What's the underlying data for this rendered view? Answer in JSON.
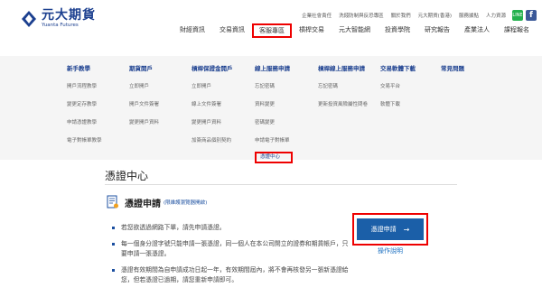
{
  "logo": {
    "cn": "元大期貨",
    "en": "Yuanta Futures"
  },
  "utility_links": [
    "企業社會責任",
    "洗錢防制與反恐專區",
    "關於我們",
    "元大期貨(香港)",
    "服務據點",
    "人力資源"
  ],
  "social": {
    "line": "LINE",
    "fb": "f"
  },
  "main_nav": [
    "財經資訊",
    "交易資訊",
    "客服專區",
    "槓桿交易",
    "元大智能網",
    "投資學院",
    "研究報告",
    "產業法人",
    "課程報名"
  ],
  "mega_menu": [
    {
      "heading": "新手教學",
      "items": [
        "開戶流程教學",
        "變更定存教學",
        "申請憑證教學",
        "電子對帳單教學"
      ]
    },
    {
      "heading": "期貨開戶",
      "items": [
        "立即開戶",
        "開戶文件簽署",
        "變更開戶資料"
      ]
    },
    {
      "heading": "槓桿保證金開戶",
      "items": [
        "立即開戶",
        "線上文件簽署",
        "變更開戶資料",
        "加簽商品個別契約"
      ]
    },
    {
      "heading": "線上服務申請",
      "items": [
        "忘記密碼",
        "資料變更",
        "密碼變更",
        "申請電子對帳單",
        "憑證中心"
      ]
    },
    {
      "heading": "槓桿線上服務申請",
      "items": [
        "忘記密碼",
        "更新投資風險屬性問卷"
      ]
    },
    {
      "heading": "交易軟體下載",
      "items": [
        "交易平台",
        "軟體下載"
      ]
    },
    {
      "heading": "常見問題",
      "items": []
    }
  ],
  "section_title": "憑證中心",
  "cert": {
    "title": "憑證申請",
    "subtitle": "(限維護瀏覽器開啟)",
    "bullets": [
      "若您欲透過網路下單，請先申請憑證。",
      "每一個身分證字號只能申請一張憑證，同一個人在本公司開立的證券和期貨帳戶，只要申請一張憑證。",
      "憑證有效期間為自申請成功日起一年，有效期間屆內，將不會再核發另一張新憑證給您，但若憑證已過期，請您重新申請即可。"
    ],
    "button_label": "憑證申請",
    "help_link": "操作說明"
  },
  "colors": {
    "brand": "#1b3f8f",
    "button": "#1b5fa8",
    "highlight": "#ee0000"
  }
}
